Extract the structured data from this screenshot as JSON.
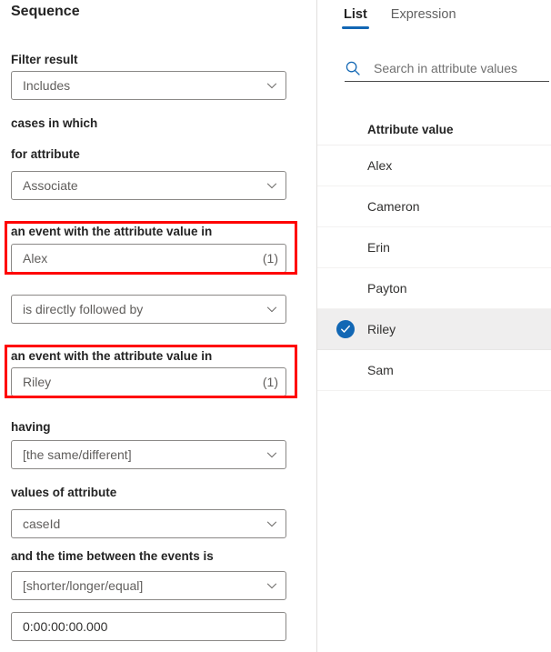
{
  "left_panel": {
    "title": "Sequence",
    "filter_result": {
      "label": "Filter result",
      "value": "Includes",
      "chevron_icon": "chevron-down-icon"
    },
    "cases_label": "cases in which",
    "for_attribute": {
      "label": "for attribute",
      "value": "Associate",
      "chevron_icon": "chevron-down-icon"
    },
    "event_one": {
      "label": "an event with the attribute value in",
      "value": "Alex",
      "count": "(1)",
      "highlighted": true,
      "highlight_color": "#ff0000"
    },
    "relation": {
      "value": "is directly followed by",
      "chevron_icon": "chevron-down-icon"
    },
    "event_two": {
      "label": "an event with the attribute value in",
      "value": "Riley",
      "count": "(1)",
      "highlighted": true,
      "highlight_color": "#ff0000"
    },
    "having": {
      "label": "having",
      "value": "[the same/different]",
      "chevron_icon": "chevron-down-icon"
    },
    "values_of_attribute": {
      "label": "values of attribute",
      "value": "caseId",
      "chevron_icon": "chevron-down-icon"
    },
    "time_between": {
      "label": "and the time between the events is",
      "operator_value": "[shorter/longer/equal]",
      "chevron_icon": "chevron-down-icon",
      "duration_value": "0:00:00:00.000"
    }
  },
  "right_panel": {
    "tabs": [
      {
        "label": "List",
        "active": true
      },
      {
        "label": "Expression",
        "active": false
      }
    ],
    "active_tab_color": "#1267b4",
    "search": {
      "placeholder": "Search in attribute values",
      "icon": "search-icon",
      "icon_color": "#1267b4"
    },
    "list": {
      "header": "Attribute value",
      "items": [
        {
          "label": "Alex",
          "selected": false
        },
        {
          "label": "Cameron",
          "selected": false
        },
        {
          "label": "Erin",
          "selected": false
        },
        {
          "label": "Payton",
          "selected": false
        },
        {
          "label": "Riley",
          "selected": true
        },
        {
          "label": "Sam",
          "selected": false
        }
      ],
      "selected_row_background": "#efeeee",
      "checkbox_color": "#1267b4"
    }
  }
}
